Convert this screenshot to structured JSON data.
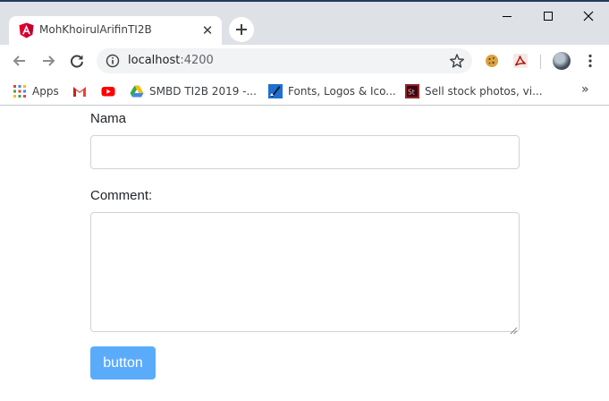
{
  "browser": {
    "tab": {
      "title": "MohKhoirulArifinTI2B",
      "favicon": "angular-icon"
    },
    "window_controls": [
      "minimize-icon",
      "maximize-icon",
      "close-icon"
    ],
    "address": {
      "host": "localhost",
      "port": ":4200"
    },
    "bookmarks": [
      {
        "label": "Apps",
        "icon": "apps-grid-icon"
      },
      {
        "label": "",
        "icon": "gmail-icon"
      },
      {
        "label": "",
        "icon": "youtube-icon"
      },
      {
        "label": "SMBD TI2B 2019 -...",
        "icon": "google-drive-icon"
      },
      {
        "label": "Fonts, Logos & Ico...",
        "icon": "fonts-site-icon"
      },
      {
        "label": "Sell stock photos, vi...",
        "icon": "adobe-stock-icon"
      }
    ],
    "bookmarks_overflow": "»"
  },
  "form": {
    "name_label": "Nama",
    "name_value": "",
    "comment_label": "Comment:",
    "comment_value": "",
    "button_label": "button"
  },
  "colors": {
    "button": "#5aacfb",
    "tab_strip": "#dee1e6",
    "angular_red": "#dd0031"
  }
}
